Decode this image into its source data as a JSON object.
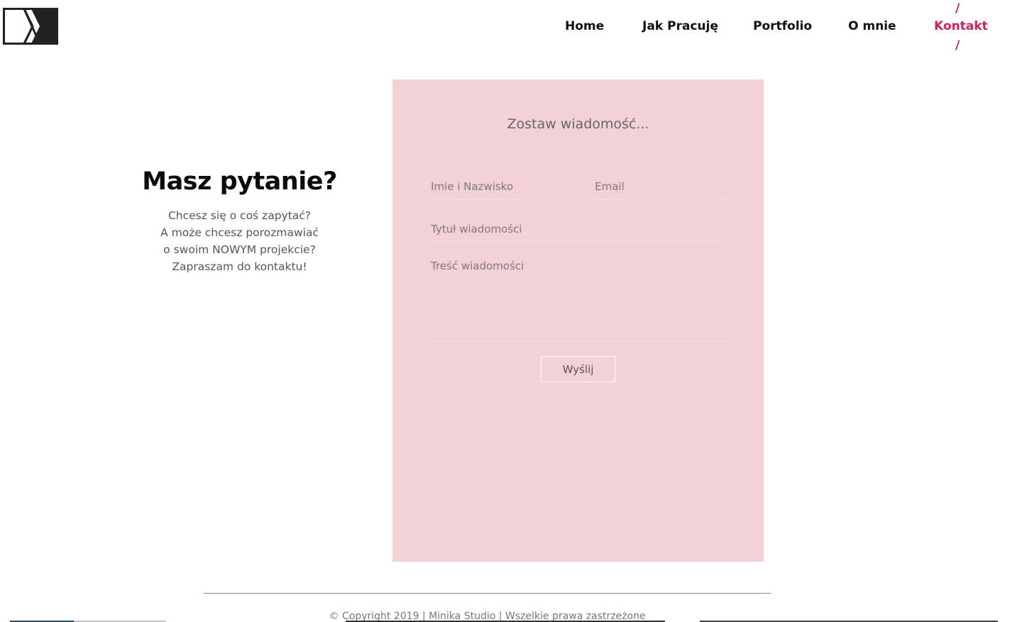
{
  "nav": {
    "items": [
      {
        "label": "Home",
        "active": false
      },
      {
        "label": "Jak Pracuję",
        "active": false
      },
      {
        "label": "Portfolio",
        "active": false
      },
      {
        "label": "O mnie",
        "active": false
      },
      {
        "label": "Kontakt",
        "active": true
      }
    ],
    "active_color": "#c8245a",
    "active_marker_top": "/",
    "active_marker_bottom": "/"
  },
  "logo": {
    "icon": "dx-logo-icon"
  },
  "intro": {
    "heading": "Masz pytanie?",
    "lines": [
      "Chcesz się o coś zapytać?",
      "A może chcesz porozmawiać",
      "o swoim NOWYM projekcie?",
      "Zapraszam do kontaktu!"
    ]
  },
  "form": {
    "title": "Zostaw wiadomość...",
    "background": "#f3d1d5",
    "name_placeholder": "Imie i Nazwisko",
    "email_placeholder": "Email",
    "subject_placeholder": "Tytuł wiadomości",
    "message_placeholder": "Treść wiadomości",
    "submit_label": "Wyślij"
  },
  "footer": {
    "text": "© Copyright 2019 | Minika Studio | Wszelkie prawa zastrzeżone"
  }
}
